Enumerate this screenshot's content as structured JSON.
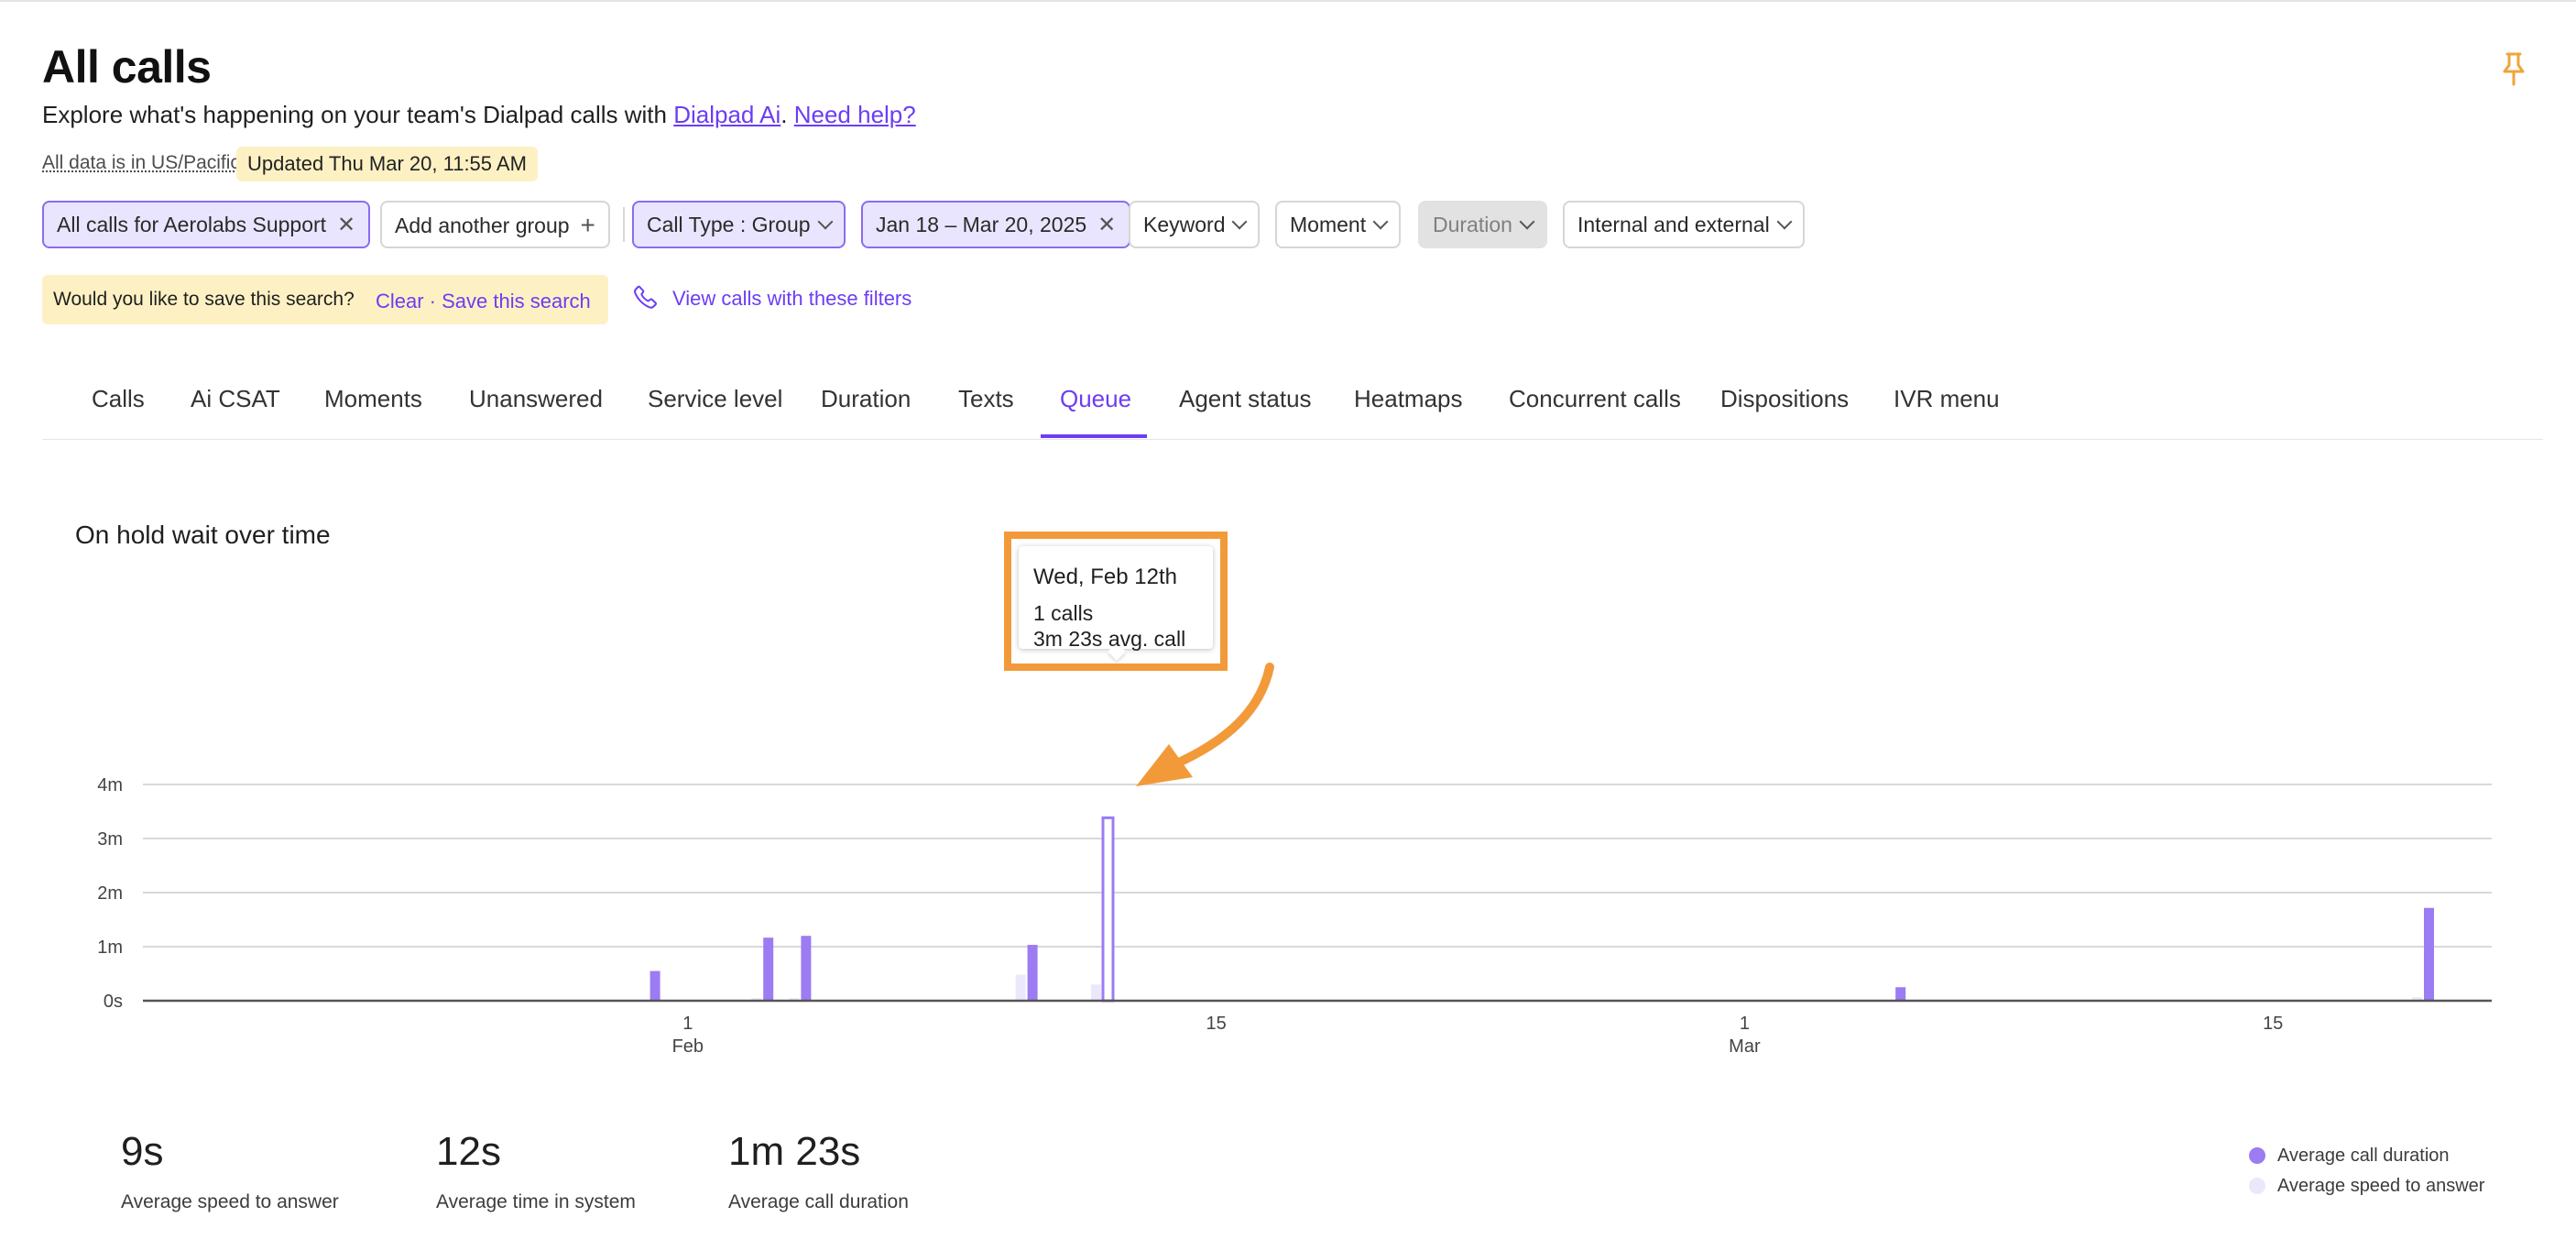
{
  "header": {
    "title": "All calls",
    "subtitle_prefix": "Explore what's happening on your team's Dialpad calls with ",
    "subtitle_link": "Dialpad Ai",
    "subtitle_sep": ". ",
    "help_link": "Need help?",
    "timezone_note": "All data is in US/Pacific",
    "updated": "Updated Thu Mar 20, 11:55 AM"
  },
  "filters": {
    "group_chip": "All calls for Aerolabs Support",
    "add_group": "Add another group",
    "call_type": "Call Type : Group",
    "date_range": "Jan 18 – Mar 20, 2025",
    "keyword": "Keyword",
    "moment": "Moment",
    "duration": "Duration",
    "scope": "Internal and external"
  },
  "save_bar": {
    "prompt": "Would you like to save this search?",
    "links": "Clear · Save this search",
    "view_calls": "View calls with these filters"
  },
  "tabs": [
    "Calls",
    "Ai CSAT",
    "Moments",
    "Unanswered",
    "Service level",
    "Duration",
    "Texts",
    "Queue",
    "Agent status",
    "Heatmaps",
    "Concurrent calls",
    "Dispositions",
    "IVR menu"
  ],
  "active_tab": "Queue",
  "colors": {
    "accent": "#6c3df4",
    "bar_primary": "#9b7cf2",
    "bar_secondary": "#ece8fb",
    "highlight": "#f29a3a"
  },
  "icons": [
    "pin-icon",
    "close-icon",
    "plus-icon",
    "chevron-down-icon",
    "phone-icon"
  ],
  "chart": {
    "title": "On hold wait over time"
  },
  "tooltip": {
    "date": "Wed, Feb 12th",
    "line1": "1 calls",
    "line2": "3m 23s avg. call"
  },
  "chart_data": {
    "type": "bar",
    "x_start": "2025-01-18",
    "x_end": "2025-03-20",
    "x_tick_labels": [
      {
        "date": "2025-02-01",
        "day": "1",
        "month": "Feb"
      },
      {
        "date": "2025-02-15",
        "day": "15",
        "month": ""
      },
      {
        "date": "2025-03-01",
        "day": "1",
        "month": "Mar"
      },
      {
        "date": "2025-03-15",
        "day": "15",
        "month": ""
      }
    ],
    "y_ticks": [
      {
        "value": 0,
        "label": "0s"
      },
      {
        "value": 60,
        "label": "1m"
      },
      {
        "value": 120,
        "label": "2m"
      },
      {
        "value": 180,
        "label": "3m"
      },
      {
        "value": 240,
        "label": "4m"
      }
    ],
    "ylim": [
      0,
      240
    ],
    "grid": true,
    "legend_position": "bottom-right",
    "series": [
      {
        "name": "Average call duration",
        "points": [
          {
            "date": "2025-01-31",
            "value": 33
          },
          {
            "date": "2025-02-03",
            "value": 70
          },
          {
            "date": "2025-02-04",
            "value": 72
          },
          {
            "date": "2025-02-10",
            "value": 62
          },
          {
            "date": "2025-02-12",
            "value": 203
          },
          {
            "date": "2025-03-05",
            "value": 15
          },
          {
            "date": "2025-03-19",
            "value": 103
          }
        ]
      },
      {
        "name": "Average speed to answer",
        "points": [
          {
            "date": "2025-02-03",
            "value": 3
          },
          {
            "date": "2025-02-04",
            "value": 3
          },
          {
            "date": "2025-02-10",
            "value": 29
          },
          {
            "date": "2025-02-12",
            "value": 18
          },
          {
            "date": "2025-03-19",
            "value": 4
          }
        ]
      }
    ]
  },
  "stats": [
    {
      "value": "9s",
      "label": "Average speed to answer"
    },
    {
      "value": "12s",
      "label": "Average time in system"
    },
    {
      "value": "1m 23s",
      "label": "Average call duration"
    }
  ]
}
